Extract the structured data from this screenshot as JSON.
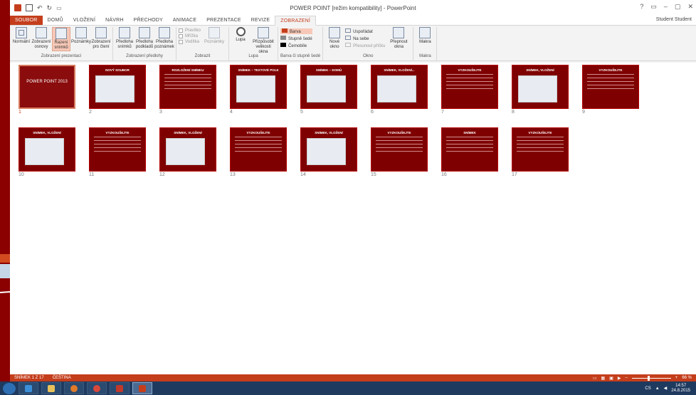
{
  "window_title": "POWER POINT [režim kompatibility] - PowerPoint",
  "user": "Student Student",
  "window_controls": [
    "?",
    "▭",
    "–",
    "▢",
    "✕"
  ],
  "tabs": [
    {
      "label": "SOUBOR",
      "kind": "file"
    },
    {
      "label": "DOMŮ"
    },
    {
      "label": "VLOŽENÍ"
    },
    {
      "label": "NÁVRH"
    },
    {
      "label": "PŘECHODY"
    },
    {
      "label": "ANIMACE"
    },
    {
      "label": "PREZENTACE"
    },
    {
      "label": "REVIZE"
    },
    {
      "label": "ZOBRAZENÍ",
      "active": true
    }
  ],
  "ribbon": {
    "presentation_views": {
      "label": "Zobrazení prezentací",
      "buttons": [
        "Normální",
        "Zobrazení osnovy",
        "Řazení snímků",
        "Poznámky",
        "Zobrazení pro čtení"
      ]
    },
    "master_views": {
      "label": "Zobrazení předlohy",
      "buttons": [
        "Předloha snímků",
        "Předloha podkladů",
        "Předloha poznámek"
      ]
    },
    "show": {
      "label": "Zobrazit",
      "checks": [
        "Pravítko",
        "Mřížka",
        "Vodítka"
      ],
      "notes": "Poznámky"
    },
    "zoom": {
      "label": "Lupa",
      "buttons": [
        "Lupa",
        "Přizpůsobit velikosti okna"
      ]
    },
    "color": {
      "label": "Barva či stupně šedé",
      "items": [
        "Barva",
        "Stupně šedé",
        "Černobíle"
      ]
    },
    "window": {
      "label": "Okno",
      "new_window": "Nové okno",
      "items": [
        "Uspořádat",
        "Na sebe",
        "Přesunout příčku"
      ],
      "switch": "Přepnout okna"
    },
    "macros": {
      "label": "Makra",
      "button": "Makra"
    }
  },
  "slides": [
    {
      "num": "1",
      "title": "POWER POINT 2013",
      "kind": "title"
    },
    {
      "num": "2",
      "title": "NOVÝ SOUBOR",
      "kind": "shot"
    },
    {
      "num": "3",
      "title": "ROZLOŽENÍ SNÍMKU",
      "kind": "lines"
    },
    {
      "num": "4",
      "title": "SNÍMEK – TEXTOVÉ POLE",
      "kind": "shot"
    },
    {
      "num": "5",
      "title": "SNÍMEK – DOMŮ",
      "kind": "shot"
    },
    {
      "num": "6",
      "title": "SNÍMEK, VLOŽENÍ...",
      "kind": "shot"
    },
    {
      "num": "7",
      "title": "VYZKOUŠEJTE",
      "kind": "lines"
    },
    {
      "num": "8",
      "title": "SNÍMEK, VLOŽENÍ",
      "kind": "shot"
    },
    {
      "num": "9",
      "title": "VYZKOUŠEJTE",
      "kind": "lines"
    },
    {
      "num": "10",
      "title": "SNÍMEK, VLOŽENÍ",
      "kind": "shot"
    },
    {
      "num": "11",
      "title": "VYZKOUŠEJTE",
      "kind": "lines"
    },
    {
      "num": "12",
      "title": "SNÍMEK, VLOŽENÍ",
      "kind": "shot"
    },
    {
      "num": "13",
      "title": "VYZKOUŠEJTE",
      "kind": "lines"
    },
    {
      "num": "14",
      "title": "SNÍMEK, VLOŽENÍ",
      "kind": "shot"
    },
    {
      "num": "15",
      "title": "VYZKOUŠEJTE",
      "kind": "lines"
    },
    {
      "num": "16",
      "title": "SNÍMEK",
      "kind": "lines"
    },
    {
      "num": "17",
      "title": "VYZKOUŠEJTE",
      "kind": "lines"
    }
  ],
  "status": {
    "slide": "SNÍMEK 1 Z 17",
    "language": "ČEŠTINA",
    "zoom": "66 %"
  },
  "taskbar": {
    "time": "14:57",
    "date": "24.8.2015",
    "lang": "CS"
  },
  "colors": {
    "accent": "#c43e1c",
    "slide_bg": "#7f0000"
  }
}
